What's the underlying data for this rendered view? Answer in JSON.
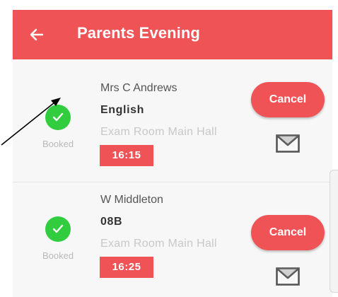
{
  "header": {
    "title": "Parents Evening",
    "back_icon": "arrow-left-icon",
    "color": "#ef5356"
  },
  "appointments": [
    {
      "teacher": "Mrs C Andrews",
      "subject": "English",
      "room": "Exam Room Main Hall",
      "time": "16:15",
      "status": "Booked",
      "status_icon": "checkmark-circle-icon",
      "cancel_label": "Cancel",
      "mail_icon": "envelope-icon"
    },
    {
      "teacher": "W Middleton",
      "subject": "08B",
      "room": "Exam Room Main Hall",
      "time": "16:25",
      "status": "Booked",
      "status_icon": "checkmark-circle-icon",
      "cancel_label": "Cancel",
      "mail_icon": "envelope-icon"
    }
  ],
  "colors": {
    "accent": "#ef5356",
    "booked_green": "#31cd3f"
  }
}
